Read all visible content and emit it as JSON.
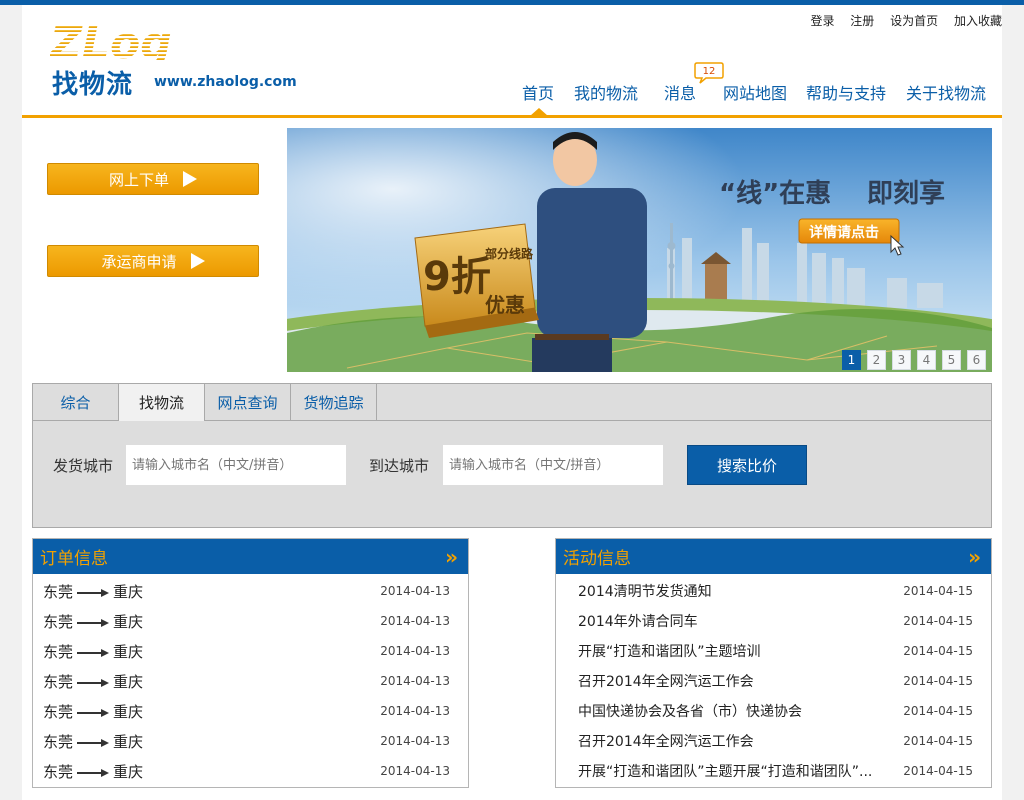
{
  "top_links": [
    "登录",
    "注册",
    "设为首页",
    "加入收藏"
  ],
  "logo": {
    "mark": "ZLog",
    "name": "找物流",
    "url": "www.zhaolog.com"
  },
  "nav": {
    "items": [
      "首页",
      "我的物流",
      "消息",
      "网站地图",
      "帮助与支持",
      "关于找物流"
    ],
    "message_count": "12",
    "active": "首页"
  },
  "side_buttons": {
    "order": "网上下单",
    "carrier": "承运商申请"
  },
  "banner": {
    "headline_quote": "“线”在惠",
    "headline_rest": "即刻享",
    "cta": "详情请点击",
    "box_big": "9折",
    "box_sub": "优惠",
    "box_tag": "部分线路",
    "pages": [
      "1",
      "2",
      "3",
      "4",
      "5",
      "6"
    ],
    "active_page": "1"
  },
  "search": {
    "tabs": [
      "综合",
      "找物流",
      "网点查询",
      "货物追踪"
    ],
    "active_tab": "找物流",
    "from_label": "发货城市",
    "to_label": "到达城市",
    "placeholder": "请输入城市名（中文/拼音）",
    "button": "搜索比价"
  },
  "orders": {
    "title": "订单信息",
    "rows": [
      {
        "from": "东莞",
        "to": "重庆",
        "date": "2014-04-13"
      },
      {
        "from": "东莞",
        "to": "重庆",
        "date": "2014-04-13"
      },
      {
        "from": "东莞",
        "to": "重庆",
        "date": "2014-04-13"
      },
      {
        "from": "东莞",
        "to": "重庆",
        "date": "2014-04-13"
      },
      {
        "from": "东莞",
        "to": "重庆",
        "date": "2014-04-13"
      },
      {
        "from": "东莞",
        "to": "重庆",
        "date": "2014-04-13"
      },
      {
        "from": "东莞",
        "to": "重庆",
        "date": "2014-04-13"
      }
    ]
  },
  "events": {
    "title": "活动信息",
    "rows": [
      {
        "text": "2014清明节发货通知",
        "date": "2014-04-15"
      },
      {
        "text": "2014年外请合同车",
        "date": "2014-04-15"
      },
      {
        "text": "开展“打造和谐团队”主题培训",
        "date": "2014-04-15"
      },
      {
        "text": "召开2014年全网汽运工作会",
        "date": "2014-04-15"
      },
      {
        "text": "中国快递协会及各省（市）快递协会",
        "date": "2014-04-15"
      },
      {
        "text": "召开2014年全网汽运工作会",
        "date": "2014-04-15"
      },
      {
        "text": "开展“打造和谐团队”主题开展“打造和谐团队”...",
        "date": "2014-04-15"
      }
    ]
  },
  "colors": {
    "brand_blue": "#0a5ea8",
    "accent_orange": "#f2a100"
  }
}
